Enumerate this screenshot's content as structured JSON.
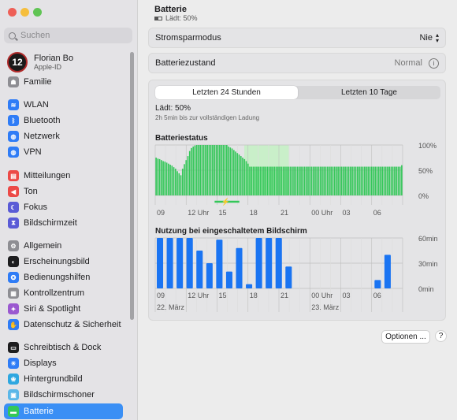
{
  "search": {
    "placeholder": "Suchen"
  },
  "user": {
    "name": "Florian Bo",
    "sub": "Apple-ID",
    "avatar_text": "12"
  },
  "sidebar": {
    "items": [
      {
        "label": "Familie",
        "color": "#8e8e93",
        "icon": "family-icon",
        "glyph": "☗"
      },
      {
        "label": "WLAN",
        "color": "#2f7cf6",
        "icon": "wifi-icon",
        "glyph": "≋"
      },
      {
        "label": "Bluetooth",
        "color": "#2f7cf6",
        "icon": "bluetooth-icon",
        "glyph": "ᛒ"
      },
      {
        "label": "Netzwerk",
        "color": "#2f7cf6",
        "icon": "globe-icon",
        "glyph": "◍"
      },
      {
        "label": "VPN",
        "color": "#2f7cf6",
        "icon": "vpn-icon",
        "glyph": "◍"
      },
      {
        "label": "Mitteilungen",
        "color": "#ec4a47",
        "icon": "bell-icon",
        "glyph": "▤"
      },
      {
        "label": "Ton",
        "color": "#ec4a47",
        "icon": "speaker-icon",
        "glyph": "◀"
      },
      {
        "label": "Fokus",
        "color": "#5a5bd6",
        "icon": "moon-icon",
        "glyph": "☾"
      },
      {
        "label": "Bildschirmzeit",
        "color": "#5a5bd6",
        "icon": "hourglass-icon",
        "glyph": "⧗"
      },
      {
        "label": "Allgemein",
        "color": "#8e8e93",
        "icon": "gear-icon",
        "glyph": "⚙"
      },
      {
        "label": "Erscheinungsbild",
        "color": "#1d1d1f",
        "icon": "appearance-icon",
        "glyph": "◐"
      },
      {
        "label": "Bedienungshilfen",
        "color": "#2f7cf6",
        "icon": "accessibility-icon",
        "glyph": "✪"
      },
      {
        "label": "Kontrollzentrum",
        "color": "#8e8e93",
        "icon": "control-center-icon",
        "glyph": "▦"
      },
      {
        "label": "Siri & Spotlight",
        "color": "#9b59d0",
        "icon": "siri-icon",
        "glyph": "✦"
      },
      {
        "label": "Datenschutz & Sicherheit",
        "color": "#2f7cf6",
        "icon": "hand-icon",
        "glyph": "✋"
      },
      {
        "label": "Schreibtisch & Dock",
        "color": "#1d1d1f",
        "icon": "dock-icon",
        "glyph": "▭"
      },
      {
        "label": "Displays",
        "color": "#2f7cf6",
        "icon": "sun-icon",
        "glyph": "☀"
      },
      {
        "label": "Hintergrundbild",
        "color": "#2ea7e0",
        "icon": "wallpaper-icon",
        "glyph": "❀"
      },
      {
        "label": "Bildschirmschoner",
        "color": "#5bb7e8",
        "icon": "screensaver-icon",
        "glyph": "▣"
      },
      {
        "label": "Batterie",
        "color": "#34c759",
        "icon": "battery-icon",
        "glyph": "▬",
        "selected": true
      }
    ]
  },
  "header": {
    "title": "Batterie",
    "subtitle": "Lädt: 50%"
  },
  "settings": {
    "low_power_label": "Stromsparmodus",
    "low_power_value": "Nie",
    "health_label": "Batteriezustand",
    "health_value": "Normal"
  },
  "tabs": {
    "last24": "Letzten 24 Stunden",
    "last10": "Letzten 10 Tage"
  },
  "charging": {
    "status": "Lädt: 50%",
    "detail": "2h 5min bis zur vollständigen Ladung"
  },
  "buttons": {
    "options": "Optionen ...",
    "help": "?"
  },
  "colors": {
    "accent": "#3a8ff5",
    "battery_green": "#34c759",
    "usage_blue": "#1a74f2",
    "charging_band": "#c9efc9"
  },
  "chart_data": [
    {
      "type": "bar",
      "title": "Batteriestatus",
      "x_ticks": [
        "09",
        "12 Uhr",
        "15",
        "18",
        "21",
        "00 Uhr",
        "03",
        "06"
      ],
      "y_ticks": [
        "100%",
        "50%",
        "0%"
      ],
      "ylim": [
        0,
        100
      ],
      "values": [
        75,
        73,
        72,
        70,
        68,
        67,
        65,
        63,
        61,
        59,
        56,
        53,
        48,
        44,
        40,
        53,
        62,
        70,
        78,
        88,
        94,
        97,
        99,
        100,
        100,
        100,
        100,
        100,
        100,
        100,
        100,
        100,
        100,
        100,
        100,
        100,
        100,
        100,
        100,
        100,
        100,
        97,
        95,
        93,
        90,
        87,
        84,
        81,
        78,
        75,
        72,
        68,
        63,
        57,
        57,
        57,
        57,
        57,
        57,
        57,
        57,
        57,
        57,
        57,
        57,
        57,
        57,
        57,
        57,
        57,
        57,
        57,
        57,
        57,
        57,
        57,
        57,
        57,
        57,
        57,
        57,
        57,
        57,
        57,
        57,
        57,
        57,
        57,
        57,
        57,
        57,
        57,
        57,
        57,
        57,
        57,
        57,
        57,
        57,
        57,
        57,
        57,
        57,
        57,
        57,
        57,
        57,
        57,
        57,
        57,
        57,
        57,
        57,
        57,
        57,
        57,
        57,
        57,
        57,
        57,
        57,
        57,
        57,
        57,
        57,
        57,
        57,
        57,
        57,
        57,
        57,
        57,
        57,
        57,
        57,
        57,
        57,
        57,
        57,
        60
      ],
      "charging_start": 0.36,
      "charging_end": 0.72
    },
    {
      "type": "bar",
      "title": "Nutzung bei eingeschaltetem Bildschirm",
      "x_ticks": [
        "09",
        "12 Uhr",
        "15",
        "18",
        "21",
        "00 Uhr",
        "03",
        "06"
      ],
      "date_labels": [
        "22. März",
        "23. März"
      ],
      "y_ticks": [
        "60min",
        "30min",
        "0min"
      ],
      "ylim": [
        0,
        60
      ],
      "values": [
        60,
        60,
        60,
        60,
        45,
        30,
        58,
        20,
        48,
        5,
        60,
        60,
        60,
        26,
        0,
        0,
        0,
        0,
        0,
        0,
        0,
        0,
        10,
        40,
        0
      ]
    }
  ]
}
